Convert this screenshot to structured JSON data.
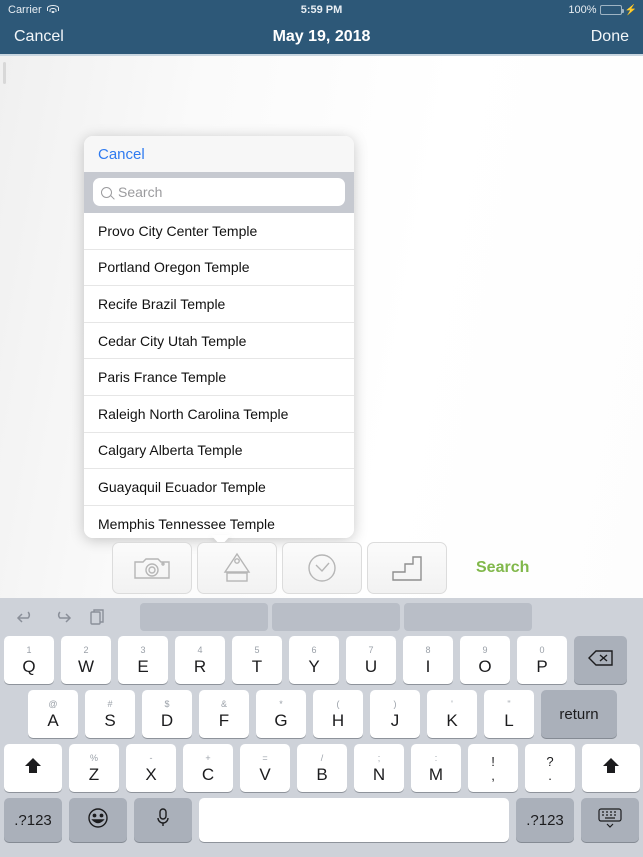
{
  "status_bar": {
    "carrier": "Carrier",
    "wifi_icon": "wifi-icon",
    "time": "5:59 PM",
    "battery_percent": "100%",
    "battery_icon": "battery-full-icon",
    "charging_icon": "lightning-bolt-icon"
  },
  "nav_bar": {
    "cancel_label": "Cancel",
    "title": "May 19, 2018",
    "done_label": "Done",
    "background_color": "#2d5878"
  },
  "popover": {
    "cancel_label": "Cancel",
    "search_placeholder": "Search",
    "search_value": "",
    "search_icon": "magnifier-icon",
    "items": [
      {
        "label": "Provo City Center Temple"
      },
      {
        "label": "Portland Oregon Temple"
      },
      {
        "label": "Recife Brazil Temple"
      },
      {
        "label": "Cedar City Utah Temple"
      },
      {
        "label": "Paris France Temple"
      },
      {
        "label": "Raleigh North Carolina Temple"
      },
      {
        "label": "Calgary Alberta Temple"
      },
      {
        "label": "Guayaquil Ecuador Temple"
      },
      {
        "label": "Memphis Tennessee Temple"
      }
    ]
  },
  "toolbar": {
    "buttons": [
      {
        "icon": "camera-icon",
        "name": "camera-button"
      },
      {
        "icon": "temple-icon",
        "name": "temple-button"
      },
      {
        "icon": "clock-icon",
        "name": "clock-button"
      },
      {
        "icon": "stairs-icon",
        "name": "stairs-button"
      }
    ],
    "search_label": "Search",
    "search_color": "#81b84b"
  },
  "keyboard": {
    "undo_icon": "undo-icon",
    "redo_icon": "redo-icon",
    "paste_icon": "paste-icon",
    "suggestions": [
      "",
      "",
      ""
    ],
    "row1": [
      {
        "sec": "1",
        "pri": "Q"
      },
      {
        "sec": "2",
        "pri": "W"
      },
      {
        "sec": "3",
        "pri": "E"
      },
      {
        "sec": "4",
        "pri": "R"
      },
      {
        "sec": "5",
        "pri": "T"
      },
      {
        "sec": "6",
        "pri": "Y"
      },
      {
        "sec": "7",
        "pri": "U"
      },
      {
        "sec": "8",
        "pri": "I"
      },
      {
        "sec": "9",
        "pri": "O"
      },
      {
        "sec": "0",
        "pri": "P"
      }
    ],
    "delete_icon": "backspace-icon",
    "row2": [
      {
        "sec": "@",
        "pri": "A"
      },
      {
        "sec": "#",
        "pri": "S"
      },
      {
        "sec": "$",
        "pri": "D"
      },
      {
        "sec": "&",
        "pri": "F"
      },
      {
        "sec": "*",
        "pri": "G"
      },
      {
        "sec": "(",
        "pri": "H"
      },
      {
        "sec": ")",
        "pri": "J"
      },
      {
        "sec": "'",
        "pri": "K"
      },
      {
        "sec": "\"",
        "pri": "L"
      }
    ],
    "return_label": "return",
    "row3": [
      {
        "sec": "%",
        "pri": "Z"
      },
      {
        "sec": "-",
        "pri": "X"
      },
      {
        "sec": "+",
        "pri": "C"
      },
      {
        "sec": "=",
        "pri": "V"
      },
      {
        "sec": "/",
        "pri": "B"
      },
      {
        "sec": ";",
        "pri": "N"
      },
      {
        "sec": ":",
        "pri": "M"
      },
      {
        "sec": "!",
        "pri": ","
      },
      {
        "sec": "?",
        "pri": "."
      }
    ],
    "shift_icon": "shift-arrow-icon",
    "numeric_left_label": ".?123",
    "emoji_icon": "emoji-smiley-icon",
    "mic_icon": "microphone-icon",
    "space_label": "",
    "numeric_right_label": ".?123",
    "dismiss_icon": "hide-keyboard-icon"
  }
}
